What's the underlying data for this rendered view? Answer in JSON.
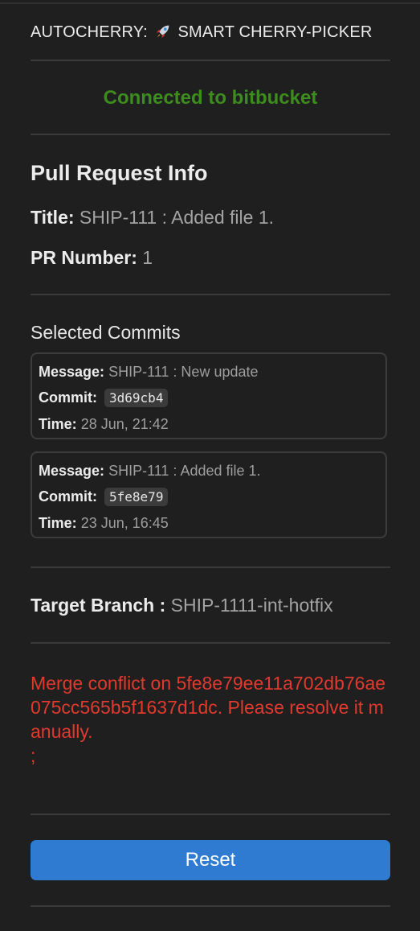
{
  "app": {
    "title_prefix": "AUTOCHERRY:",
    "title_suffix": "SMART CHERRY-PICKER",
    "title_icon": "rocket-icon"
  },
  "status": {
    "connection_text": "Connected to bitbucket",
    "connection_color": "#3c8d1e"
  },
  "pull_request": {
    "heading": "Pull Request Info",
    "title_label": "Title:",
    "title_value": "SHIP-111 : Added file 1.",
    "number_label": "PR Number:",
    "number_value": "1"
  },
  "commits": {
    "heading": "Selected Commits",
    "message_label": "Message:",
    "commit_label": "Commit:",
    "time_label": "Time:",
    "items": [
      {
        "message": "SHIP-111 : New update",
        "hash": "3d69cb4",
        "time": "28 Jun, 21:42"
      },
      {
        "message": "SHIP-111 : Added file 1.",
        "hash": "5fe8e79",
        "time": "23 Jun, 16:45"
      }
    ]
  },
  "target": {
    "label": "Target Branch :",
    "value": "SHIP-1111-int-hotfix"
  },
  "error": {
    "text": "Merge conflict on 5fe8e79ee11a702db76ae075cc565b5f1637d1dc. Please resolve it manually.\n;",
    "color": "#e03a2f"
  },
  "actions": {
    "reset_label": "Reset",
    "accent_color": "#2f7bd1"
  }
}
